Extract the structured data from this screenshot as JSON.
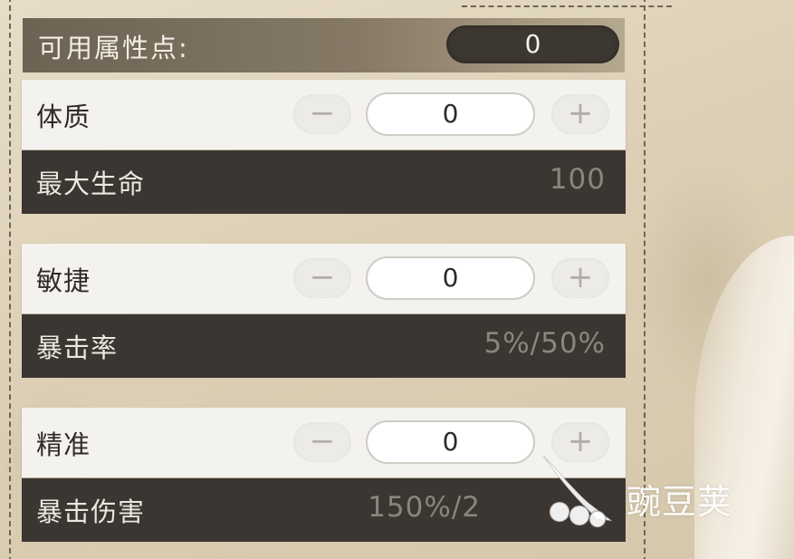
{
  "points": {
    "label": "可用属性点:",
    "value": "0"
  },
  "stats": [
    {
      "name": "体质",
      "value": "0",
      "minus": "−",
      "plus": "+",
      "derived_name": "最大生命",
      "derived_value": "100"
    },
    {
      "name": "敏捷",
      "value": "0",
      "minus": "−",
      "plus": "+",
      "derived_name": "暴击率",
      "derived_value": "5%/50%"
    },
    {
      "name": "精准",
      "value": "0",
      "minus": "−",
      "plus": "+",
      "derived_name": "暴击伤害",
      "derived_value": "150%/2"
    }
  ],
  "watermark": {
    "icon": "bean-logo-icon",
    "text": "豌豆荚"
  },
  "colors": {
    "header_bar": "#7a6f5e",
    "pill_dark": "#3d3731",
    "stat_row": "#f3f2ef",
    "derived_row": "#3b3632",
    "derived_value": "#8a857d",
    "paper": "#dccfb5"
  }
}
